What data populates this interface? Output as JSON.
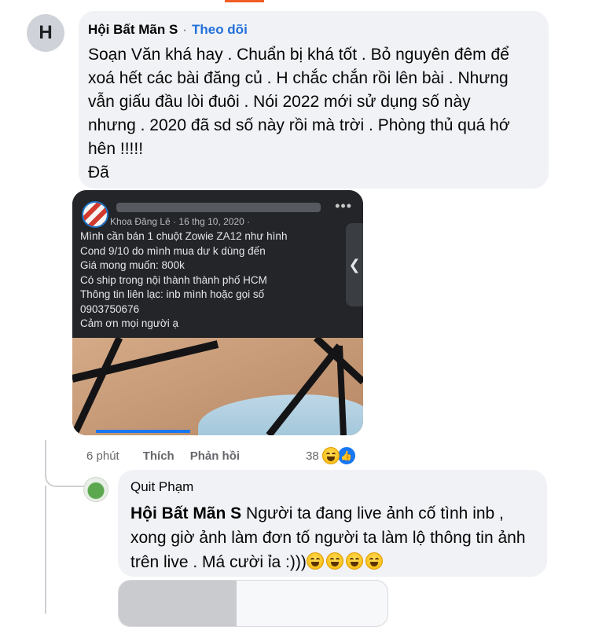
{
  "comment": {
    "avatar_letter": "H",
    "author": "Hội Bất Mãn S",
    "separator": "·",
    "follow_label": "Theo dõi",
    "text": "Soạn Văn khá hay . Chuẩn bị khá tốt . Bỏ nguyên đêm để\nxoá hết các bài đăng củ . H chắc chắn rồi lên bài . Nhưng\nvẫn giấu đầu lòi đuôi . Nói 2022 mới sử dụng số này\nnhưng . 2020 đã sd số này rồi mà trời . Phòng thủ quá hớ\nhên !!!!!\nĐã",
    "attachment": {
      "post_author": "Khoa Đăng Lê",
      "post_meta": "Khoa Đăng Lê · 16 thg 10, 2020 · ",
      "more_label": "•••",
      "side_tab_label": "❮",
      "post_text": "Mình cần bán 1 chuột Zowie ZA12 như hình\nCond 9/10 do mình mua dư k dùng đến\nGiá mong muốn: 800k\nCó ship trong nội thành thành phố HCM\nThông tin liên lạc: inb mình hoặc gọi số\n0903750676\nCảm ơn mọi người ạ"
    },
    "time": "6 phút",
    "like_label": "Thích",
    "reply_label": "Phản hồi",
    "reaction_count": "38",
    "reactions": [
      "haha-icon",
      "like-icon"
    ]
  },
  "reply": {
    "author": "Quit Phạm",
    "mention": "Hội Bất Mãn S",
    "text": " Người ta đang live ảnh cố tình inb , xong giờ ảnh làm đơn tố người ta làm lộ thông tin ảnh trên live . Má cười ỉa :)))",
    "emoji_count": 4
  },
  "colors": {
    "follow": "#216fdb",
    "bubble": "#f0f2f5",
    "like": "#1877f2",
    "accent": "#f25c22"
  }
}
